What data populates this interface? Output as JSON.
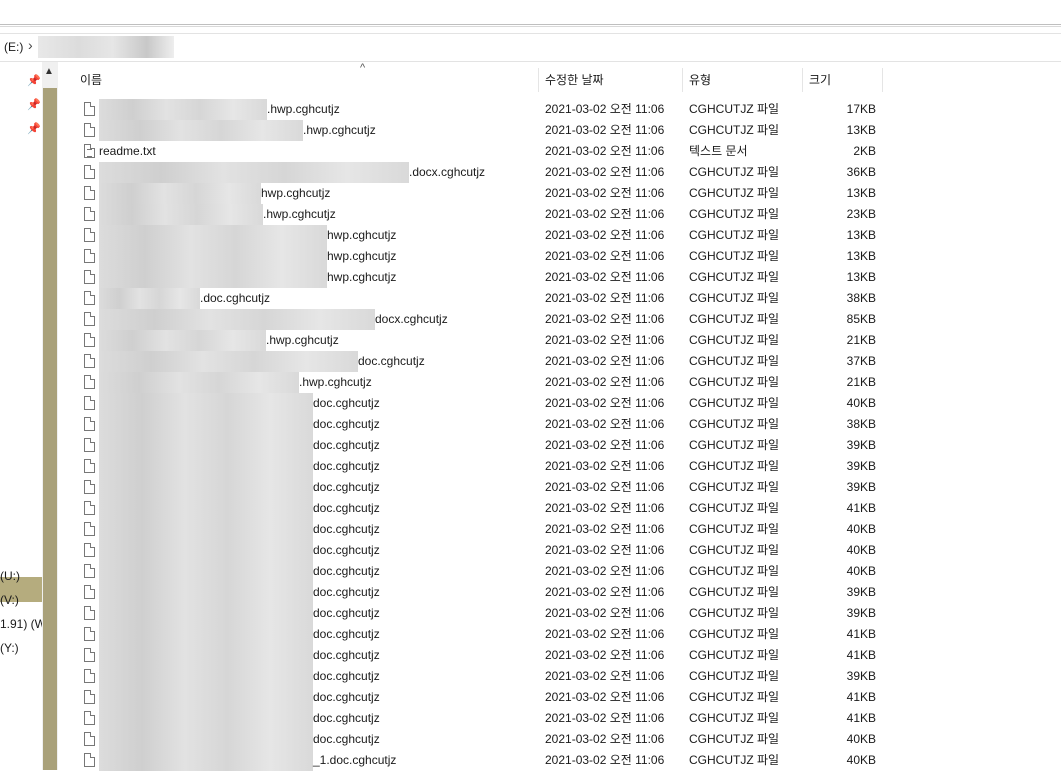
{
  "address": {
    "drive": "(E:)",
    "separator": "›"
  },
  "nav": {
    "drives": [
      "(U:)",
      "(V:)",
      "1.91) (W",
      "(Y:)"
    ]
  },
  "columns": {
    "name": "이름",
    "modified": "수정한 날짜",
    "type": "유형",
    "size": "크기"
  },
  "files": [
    {
      "name": ".hwp.cghcutjz",
      "redact_w": 168,
      "date": "2021-03-02 오전 11:06",
      "type": "CGHCUTJZ 파일",
      "size": "17KB"
    },
    {
      "name": ".hwp.cghcutjz",
      "redact_w": 204,
      "date": "2021-03-02 오전 11:06",
      "type": "CGHCUTJZ 파일",
      "size": "13KB"
    },
    {
      "name": "readme.txt",
      "redact_w": 0,
      "icon": "txt",
      "date": "2021-03-02 오전 11:06",
      "type": "텍스트 문서",
      "size": "2KB"
    },
    {
      "name": ".docx.cghcutjz",
      "redact_w": 310,
      "date": "2021-03-02 오전 11:06",
      "type": "CGHCUTJZ 파일",
      "size": "36KB"
    },
    {
      "name": "hwp.cghcutjz",
      "redact_w": 162,
      "date": "2021-03-02 오전 11:06",
      "type": "CGHCUTJZ 파일",
      "size": "13KB"
    },
    {
      "name": ".hwp.cghcutjz",
      "redact_w": 164,
      "date": "2021-03-02 오전 11:06",
      "type": "CGHCUTJZ 파일",
      "size": "23KB"
    },
    {
      "name": "hwp.cghcutjz",
      "redact_w": 228,
      "date": "2021-03-02 오전 11:06",
      "type": "CGHCUTJZ 파일",
      "size": "13KB"
    },
    {
      "name": "hwp.cghcutjz",
      "redact_w": 228,
      "date": "2021-03-02 오전 11:06",
      "type": "CGHCUTJZ 파일",
      "size": "13KB"
    },
    {
      "name": "hwp.cghcutjz",
      "redact_w": 228,
      "date": "2021-03-02 오전 11:06",
      "type": "CGHCUTJZ 파일",
      "size": "13KB"
    },
    {
      "name": ".doc.cghcutjz",
      "redact_w": 101,
      "date": "2021-03-02 오전 11:06",
      "type": "CGHCUTJZ 파일",
      "size": "38KB"
    },
    {
      "name": "docx.cghcutjz",
      "redact_w": 276,
      "date": "2021-03-02 오전 11:06",
      "type": "CGHCUTJZ 파일",
      "size": "85KB"
    },
    {
      "name": ".hwp.cghcutjz",
      "redact_w": 167,
      "date": "2021-03-02 오전 11:06",
      "type": "CGHCUTJZ 파일",
      "size": "21KB"
    },
    {
      "name": "doc.cghcutjz",
      "redact_w": 259,
      "date": "2021-03-02 오전 11:06",
      "type": "CGHCUTJZ 파일",
      "size": "37KB"
    },
    {
      "name": ".hwp.cghcutjz",
      "redact_w": 200,
      "date": "2021-03-02 오전 11:06",
      "type": "CGHCUTJZ 파일",
      "size": "21KB"
    },
    {
      "name": "doc.cghcutjz",
      "redact_w": 214,
      "date": "2021-03-02 오전 11:06",
      "type": "CGHCUTJZ 파일",
      "size": "40KB"
    },
    {
      "name": "doc.cghcutjz",
      "redact_w": 214,
      "date": "2021-03-02 오전 11:06",
      "type": "CGHCUTJZ 파일",
      "size": "38KB"
    },
    {
      "name": "doc.cghcutjz",
      "redact_w": 214,
      "date": "2021-03-02 오전 11:06",
      "type": "CGHCUTJZ 파일",
      "size": "39KB"
    },
    {
      "name": "doc.cghcutjz",
      "redact_w": 214,
      "date": "2021-03-02 오전 11:06",
      "type": "CGHCUTJZ 파일",
      "size": "39KB"
    },
    {
      "name": "doc.cghcutjz",
      "redact_w": 214,
      "date": "2021-03-02 오전 11:06",
      "type": "CGHCUTJZ 파일",
      "size": "39KB"
    },
    {
      "name": "doc.cghcutjz",
      "redact_w": 214,
      "date": "2021-03-02 오전 11:06",
      "type": "CGHCUTJZ 파일",
      "size": "41KB"
    },
    {
      "name": "doc.cghcutjz",
      "redact_w": 214,
      "date": "2021-03-02 오전 11:06",
      "type": "CGHCUTJZ 파일",
      "size": "40KB"
    },
    {
      "name": "doc.cghcutjz",
      "redact_w": 214,
      "date": "2021-03-02 오전 11:06",
      "type": "CGHCUTJZ 파일",
      "size": "40KB"
    },
    {
      "name": "doc.cghcutjz",
      "redact_w": 214,
      "date": "2021-03-02 오전 11:06",
      "type": "CGHCUTJZ 파일",
      "size": "40KB"
    },
    {
      "name": "doc.cghcutjz",
      "redact_w": 214,
      "date": "2021-03-02 오전 11:06",
      "type": "CGHCUTJZ 파일",
      "size": "39KB"
    },
    {
      "name": "doc.cghcutjz",
      "redact_w": 214,
      "date": "2021-03-02 오전 11:06",
      "type": "CGHCUTJZ 파일",
      "size": "39KB"
    },
    {
      "name": "doc.cghcutjz",
      "redact_w": 214,
      "date": "2021-03-02 오전 11:06",
      "type": "CGHCUTJZ 파일",
      "size": "41KB"
    },
    {
      "name": "doc.cghcutjz",
      "redact_w": 214,
      "date": "2021-03-02 오전 11:06",
      "type": "CGHCUTJZ 파일",
      "size": "41KB"
    },
    {
      "name": "doc.cghcutjz",
      "redact_w": 214,
      "date": "2021-03-02 오전 11:06",
      "type": "CGHCUTJZ 파일",
      "size": "39KB"
    },
    {
      "name": "doc.cghcutjz",
      "redact_w": 214,
      "date": "2021-03-02 오전 11:06",
      "type": "CGHCUTJZ 파일",
      "size": "41KB"
    },
    {
      "name": "doc.cghcutjz",
      "redact_w": 214,
      "date": "2021-03-02 오전 11:06",
      "type": "CGHCUTJZ 파일",
      "size": "41KB"
    },
    {
      "name": "doc.cghcutjz",
      "redact_w": 214,
      "date": "2021-03-02 오전 11:06",
      "type": "CGHCUTJZ 파일",
      "size": "40KB"
    },
    {
      "name": "_1.doc.cghcutjz",
      "redact_w": 214,
      "date": "2021-03-02 오전 11:06",
      "type": "CGHCUTJZ 파일",
      "size": "40KB"
    }
  ]
}
